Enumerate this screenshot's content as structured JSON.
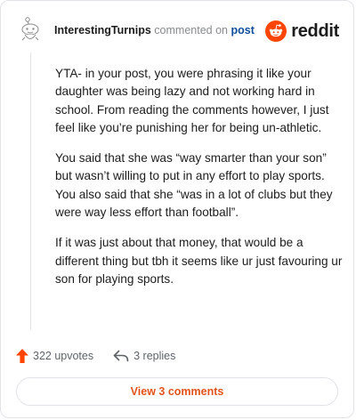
{
  "header": {
    "username": "InterestingTurnips",
    "action_text": "commented on",
    "post_link": "post",
    "brand": "reddit",
    "colors": {
      "brand_orange": "#ff4500",
      "link_blue": "#0f4c9a"
    },
    "icons": {
      "avatar": "snoo-avatar-icon",
      "brand": "reddit-logo-icon"
    }
  },
  "comment": {
    "paragraphs": [
      "YTA- in your post, you were phrasing it like your daughter was being lazy and not working hard in school. From reading the comments however, I just feel like you’re punishing her for being un-athletic.",
      "You said that she was “way smarter than your son” but wasn’t willing to put in any effort to play sports. You also said that she “was in a lot of clubs but they were way less effort than football”.",
      "If it was just about that money, that would be a different thing but tbh it seems like ur just favouring ur son for playing sports."
    ]
  },
  "actions": {
    "upvotes": "322 upvotes",
    "replies": "3 replies",
    "icons": {
      "upvote": "upvote-arrow-icon",
      "reply": "reply-arrow-icon"
    },
    "colors": {
      "upvote": "#ff4500"
    }
  },
  "footer": {
    "view_comments": "View 3 comments",
    "colors": {
      "button_text": "#e2531c"
    }
  }
}
